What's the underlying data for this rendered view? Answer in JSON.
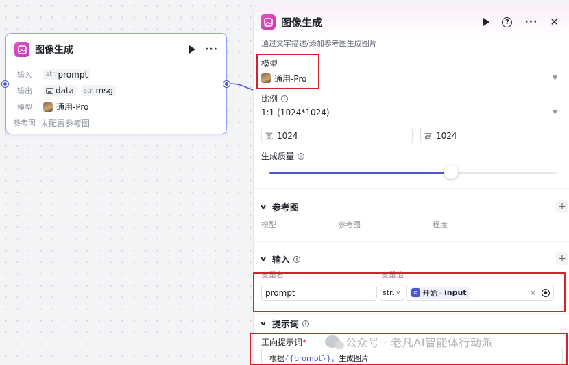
{
  "node": {
    "title": "图像生成",
    "inputs_label": "输入",
    "input_type": "str.",
    "input_name": "prompt",
    "outputs_label": "输出",
    "output_data": "data",
    "output_msg_type": "str.",
    "output_msg": "msg",
    "model_label": "模型",
    "model_value": "通用-Pro",
    "ref_label": "参考图",
    "ref_value": "未配置参考图"
  },
  "panel": {
    "title": "图像生成",
    "description": "通过文字描述/添加参考图生成图片",
    "model": {
      "label": "模型",
      "value": "通用-Pro"
    },
    "ratio": {
      "label": "比例",
      "value": "1:1 (1024*1024)"
    },
    "width": {
      "label": "宽",
      "value": "1024"
    },
    "height": {
      "label": "高",
      "value": "1024"
    },
    "quality": {
      "label": "生成质量",
      "level": 0.63
    },
    "reference": {
      "title": "参考图",
      "col_model": "模型",
      "col_ref": "参考图",
      "col_degree": "程度"
    },
    "inputs": {
      "title": "输入",
      "col_name": "变量名",
      "col_value": "变量值",
      "var_name": "prompt",
      "var_type": "str.",
      "ref_source": "开始",
      "ref_sep": "-",
      "ref_var": "input"
    },
    "prompt": {
      "title": "提示词",
      "positive_label": "正向提示词",
      "required_mark": "*",
      "text_prefix": "根据",
      "text_var": "{{prompt}}",
      "text_suffix": "，生成图片"
    }
  },
  "watermark": "公众号 · 老凡AI智能体行动派",
  "colors": {
    "accent": "#4c53d6",
    "highlight": "#d9202a",
    "app_icon": "#d14bbd"
  }
}
